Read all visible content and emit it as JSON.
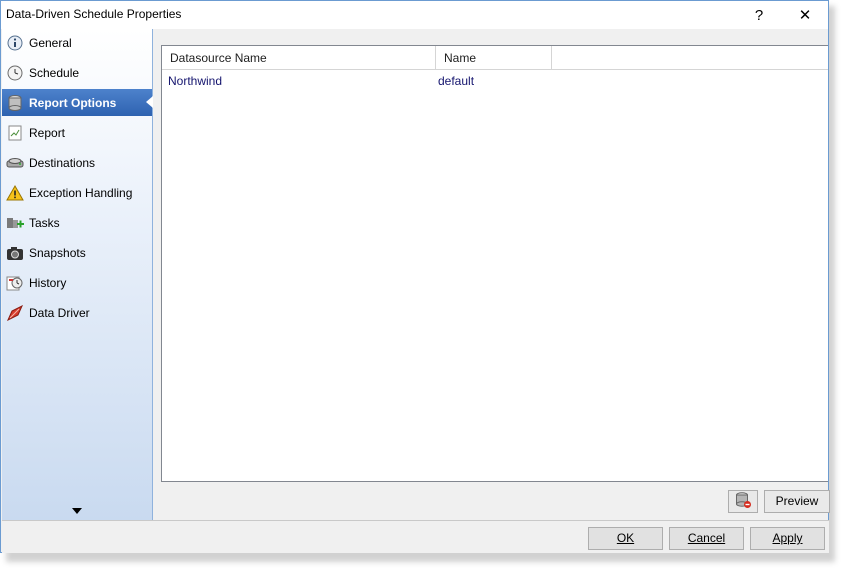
{
  "window": {
    "title": "Data-Driven Schedule Properties",
    "help_glyph": "?",
    "close_glyph": "✕"
  },
  "sidebar": {
    "items": [
      {
        "label": "General",
        "icon": "info-icon"
      },
      {
        "label": "Schedule",
        "icon": "clock-icon"
      },
      {
        "label": "Report Options",
        "icon": "database-icon",
        "active": true
      },
      {
        "label": "Report",
        "icon": "report-icon"
      },
      {
        "label": "Destinations",
        "icon": "destinations-icon"
      },
      {
        "label": "Exception Handling",
        "icon": "warning-icon"
      },
      {
        "label": "Tasks",
        "icon": "tasks-icon"
      },
      {
        "label": "Snapshots",
        "icon": "camera-icon"
      },
      {
        "label": "History",
        "icon": "history-icon"
      },
      {
        "label": "Data Driver",
        "icon": "data-driver-icon"
      }
    ],
    "scroll_icon": "chevron-down-icon"
  },
  "grid": {
    "columns": [
      "Datasource Name",
      "Name"
    ],
    "rows": [
      [
        "Northwind",
        "default"
      ]
    ]
  },
  "buttons": {
    "preview": "Preview",
    "ok": "OK",
    "cancel": "Cancel",
    "apply": "Apply"
  },
  "colors": {
    "active_item": "#2e62b0",
    "cell_text": "#14146e",
    "border_accent": "#6b9bd1"
  }
}
